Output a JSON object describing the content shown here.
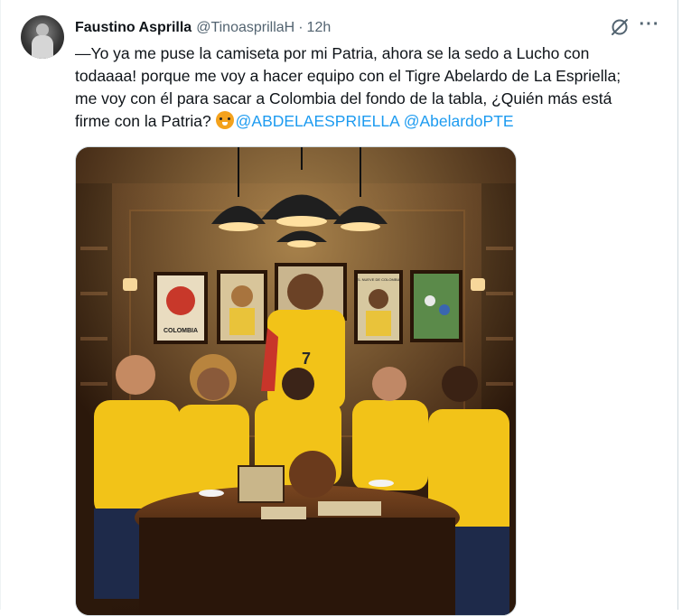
{
  "tweet": {
    "author_name": "Faustino Asprilla",
    "author_handle": "@TinoasprillaH",
    "separator": "·",
    "timestamp": "12h",
    "text_part1": "—Yo ya me puse la camiseta por mi Patria, ahora se la sedo a Lucho con todaaaa! porque me voy a hacer equipo con el Tigre Abelardo de La Espriella; me voy con él para sacar a Colombia del fondo de la tabla, ¿Quién más está firme con la Patria?",
    "mention_1": "@ABDELAESPRIELLA",
    "mention_2": "@AbelardoPTE",
    "emoji_icon": "tiger-face-icon",
    "more_label": "···"
  },
  "media": {
    "poster_label": "COLOMBIA",
    "poster_label_2": "EL NUEVE DE COLOMBIA",
    "jersey_number": "7"
  },
  "colors": {
    "link": "#1d9bf0",
    "muted": "#536471",
    "text": "#0f1419",
    "jersey_yellow": "#f2c318",
    "wood_dark": "#3b2414"
  }
}
